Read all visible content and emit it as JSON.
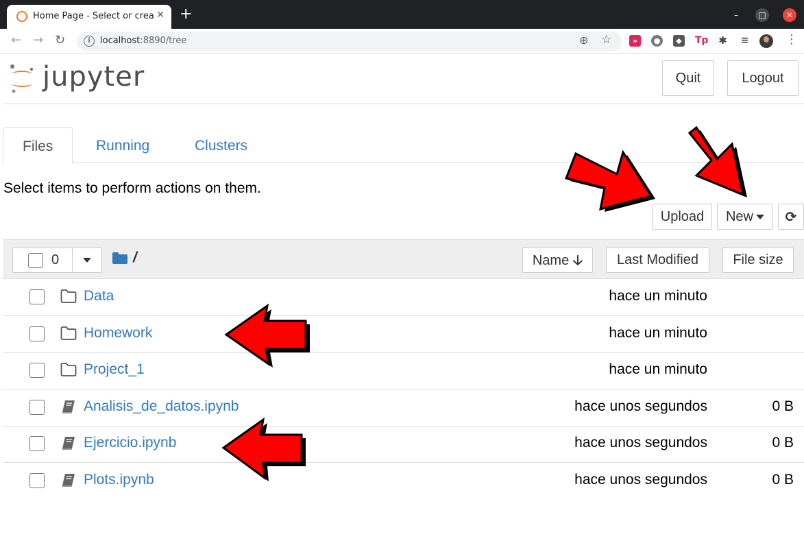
{
  "browser": {
    "tab_title": "Home Page - Select or create a notebook",
    "new_tab": "+",
    "tab_close": "✕",
    "url_host": "localhost",
    "url_rest": ":8890/tree",
    "window_controls": {
      "minimize": "–",
      "maximize": "□",
      "close": "✕"
    },
    "nav": {
      "back": "←",
      "forward": "→",
      "reload": "↻"
    },
    "omnibox_icons": {
      "zoom": "⊕",
      "star": "☆"
    },
    "extensions": [
      "»",
      "●",
      "◆",
      "Tp",
      "✱",
      "≡"
    ],
    "menu": "⋮"
  },
  "jupyter": {
    "logo_text": "jupyter",
    "quit_label": "Quit",
    "logout_label": "Logout",
    "tabs": [
      {
        "label": "Files",
        "active": true
      },
      {
        "label": "Running",
        "active": false
      },
      {
        "label": "Clusters",
        "active": false
      }
    ],
    "hint": "Select items to perform actions on them.",
    "upload_label": "Upload",
    "new_label": "New",
    "refresh_icon": "⟳",
    "selected_count": "0",
    "breadcrumb": "/",
    "columns": {
      "name": "Name",
      "name_sort_icon": "🡣",
      "last_modified": "Last Modified",
      "file_size": "File size"
    },
    "rows": [
      {
        "name": "Data",
        "type": "folder",
        "modified": "hace un minuto",
        "size": ""
      },
      {
        "name": "Homework",
        "type": "folder",
        "modified": "hace un minuto",
        "size": ""
      },
      {
        "name": "Project_1",
        "type": "folder",
        "modified": "hace un minuto",
        "size": ""
      },
      {
        "name": "Analisis_de_datos.ipynb",
        "type": "notebook",
        "modified": "hace unos segundos",
        "size": "0 B"
      },
      {
        "name": "Ejercicio.ipynb",
        "type": "notebook",
        "modified": "hace unos segundos",
        "size": "0 B"
      },
      {
        "name": "Plots.ipynb",
        "type": "notebook",
        "modified": "hace unos segundos",
        "size": "0 B"
      }
    ]
  },
  "colors": {
    "link": "#337ab7",
    "jupyter_orange": "#f37726",
    "annotation_red": "#ff0000"
  }
}
